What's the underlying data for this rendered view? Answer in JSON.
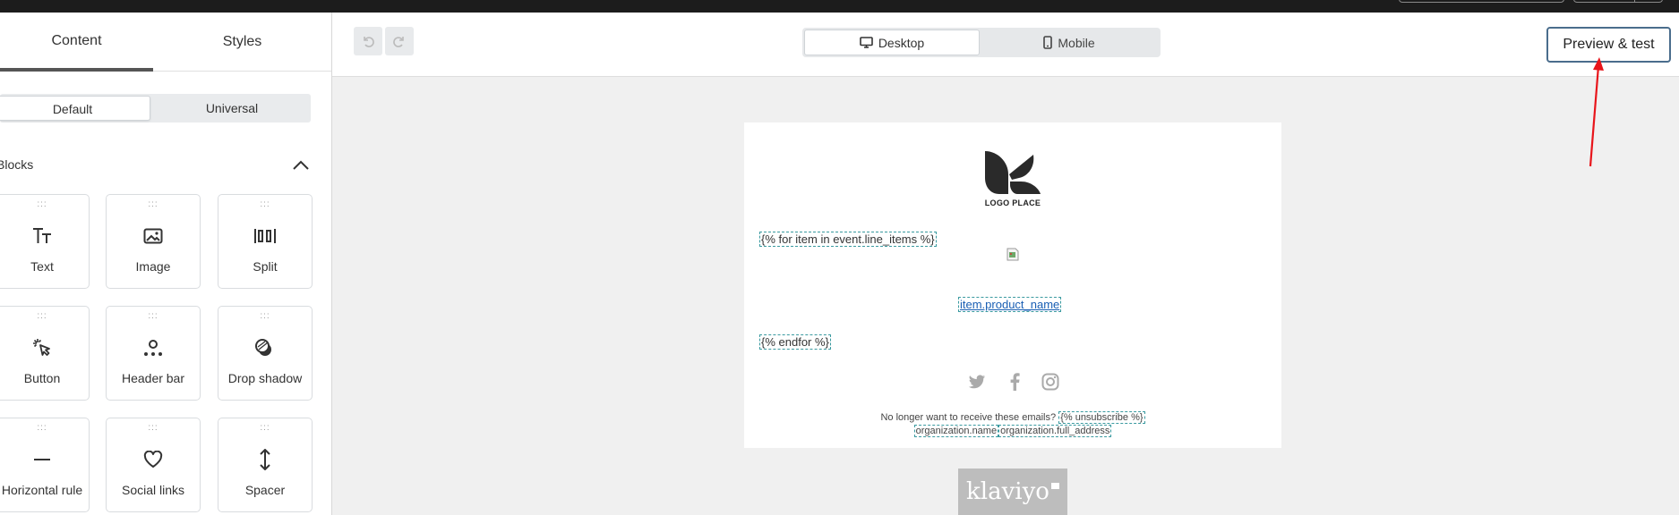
{
  "sidebar": {
    "tabs": {
      "content": "Content",
      "styles": "Styles"
    },
    "segment": {
      "default": "Default",
      "universal": "Universal"
    },
    "blocks_heading": "Blocks",
    "blocks": [
      {
        "label": "Text",
        "icon": "text-icon"
      },
      {
        "label": "Image",
        "icon": "image-icon"
      },
      {
        "label": "Split",
        "icon": "split-icon"
      },
      {
        "label": "Button",
        "icon": "cursor-click-icon"
      },
      {
        "label": "Header bar",
        "icon": "header-bar-icon"
      },
      {
        "label": "Drop shadow",
        "icon": "drop-shadow-icon"
      },
      {
        "label": "Horizontal rule",
        "icon": "horizontal-rule-icon"
      },
      {
        "label": "Social links",
        "icon": "heart-icon"
      },
      {
        "label": "Spacer",
        "icon": "spacer-arrows-icon"
      }
    ]
  },
  "toolbar": {
    "desktop_label": "Desktop",
    "mobile_label": "Mobile",
    "preview_label": "Preview & test"
  },
  "email": {
    "logo_text": "LOGO PLACE",
    "for_tag": "{% for item in event.line_items %}",
    "product_name_tag": "item.product_name",
    "endfor_tag": "{% endfor %}",
    "footer_text": "No longer want to receive these emails?",
    "unsubscribe_tag": "{% unsubscribe %}",
    "org_name_tag": "organization.name",
    "org_address_tag": "organization.full_address"
  },
  "branding": {
    "klaviyo": "klaviyo"
  },
  "colors": {
    "annotation_arrow": "#e8151b",
    "tag_border": "#3a9aa0",
    "preview_border": "#4a6d8c"
  }
}
